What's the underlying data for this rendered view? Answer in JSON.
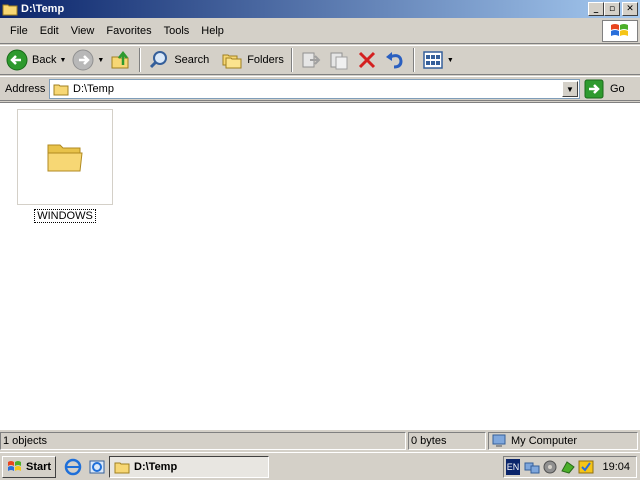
{
  "window": {
    "title": "D:\\Temp",
    "buttons": [
      "minimize",
      "maximize",
      "close"
    ]
  },
  "menu": {
    "items": [
      "File",
      "Edit",
      "View",
      "Favorites",
      "Tools",
      "Help"
    ]
  },
  "toolbar": {
    "back_label": "Back",
    "search_label": "Search",
    "folders_label": "Folders"
  },
  "address": {
    "label": "Address",
    "value": "D:\\Temp",
    "go_label": "Go"
  },
  "files": [
    {
      "name": "WINDOWS",
      "type": "folder"
    }
  ],
  "status": {
    "objects": "1 objects",
    "size": "0 bytes",
    "location": "My Computer"
  },
  "taskbar": {
    "start_label": "Start",
    "task_label": "D:\\Temp",
    "lang": "EN",
    "clock": "19:04"
  },
  "colors": {
    "title_start": "#0a246a",
    "title_end": "#a6caf0",
    "chrome": "#d4d0c8",
    "folder": "#f7d774"
  }
}
